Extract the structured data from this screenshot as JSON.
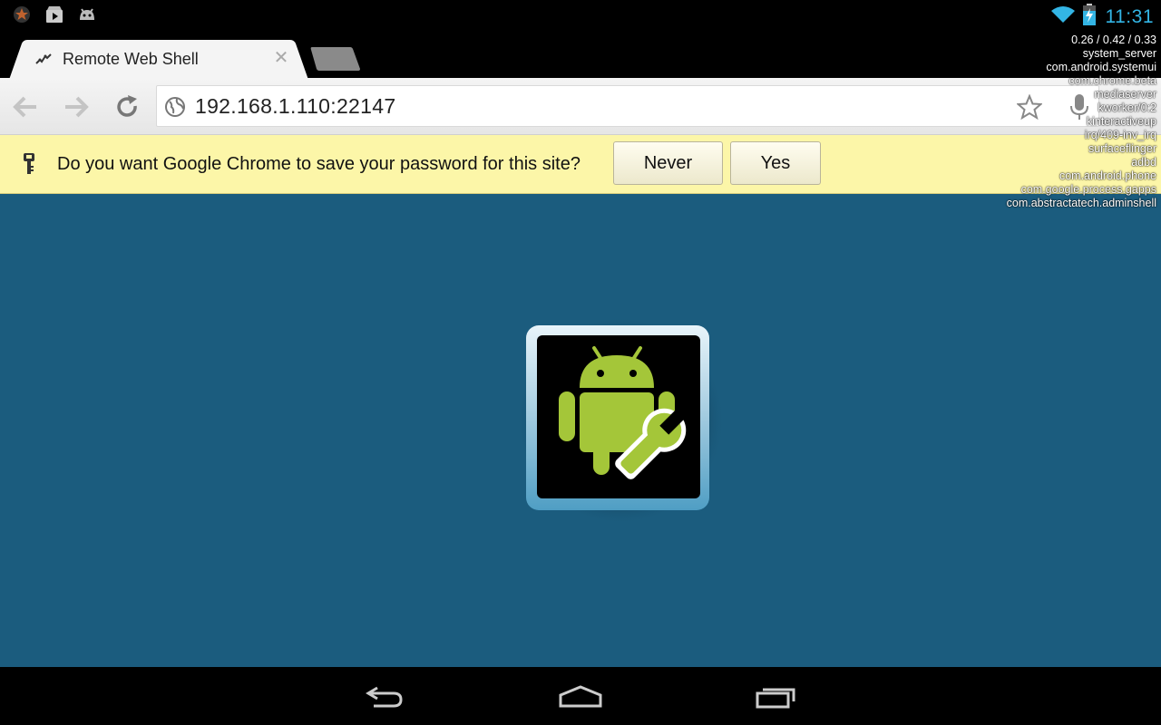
{
  "status_bar": {
    "notification_icons": [
      "star-notification-icon",
      "play-store-icon",
      "android-debug-icon"
    ],
    "wifi_icon": "wifi-icon",
    "battery_icon": "battery-charging-icon",
    "clock": "11:31"
  },
  "browser": {
    "tab": {
      "title": "Remote Web Shell",
      "close_icon": "close-icon"
    },
    "toolbar": {
      "url": "192.168.1.110:22147"
    },
    "infobar": {
      "message": "Do you want Google Chrome to save your password for this site?",
      "never_label": "Never",
      "yes_label": "Yes"
    }
  },
  "cpu_overlay": {
    "load": "0.26 / 0.42 / 0.33",
    "processes": [
      "system_server",
      "com.android.systemui",
      "com.chrome.beta",
      "mediaserver",
      "kworker/0:2",
      "kinteractiveup",
      "irq/409-inv_irq",
      "surfaceflinger",
      "adbd",
      "com.android.phone",
      "com.google.process.gapps",
      "com.abstractatech.adminshell"
    ]
  },
  "colors": {
    "content_bg": "#1b5c7e",
    "infobar_bg": "#fcf6a8",
    "clock": "#33b5e5",
    "android_green": "#a4c639"
  }
}
